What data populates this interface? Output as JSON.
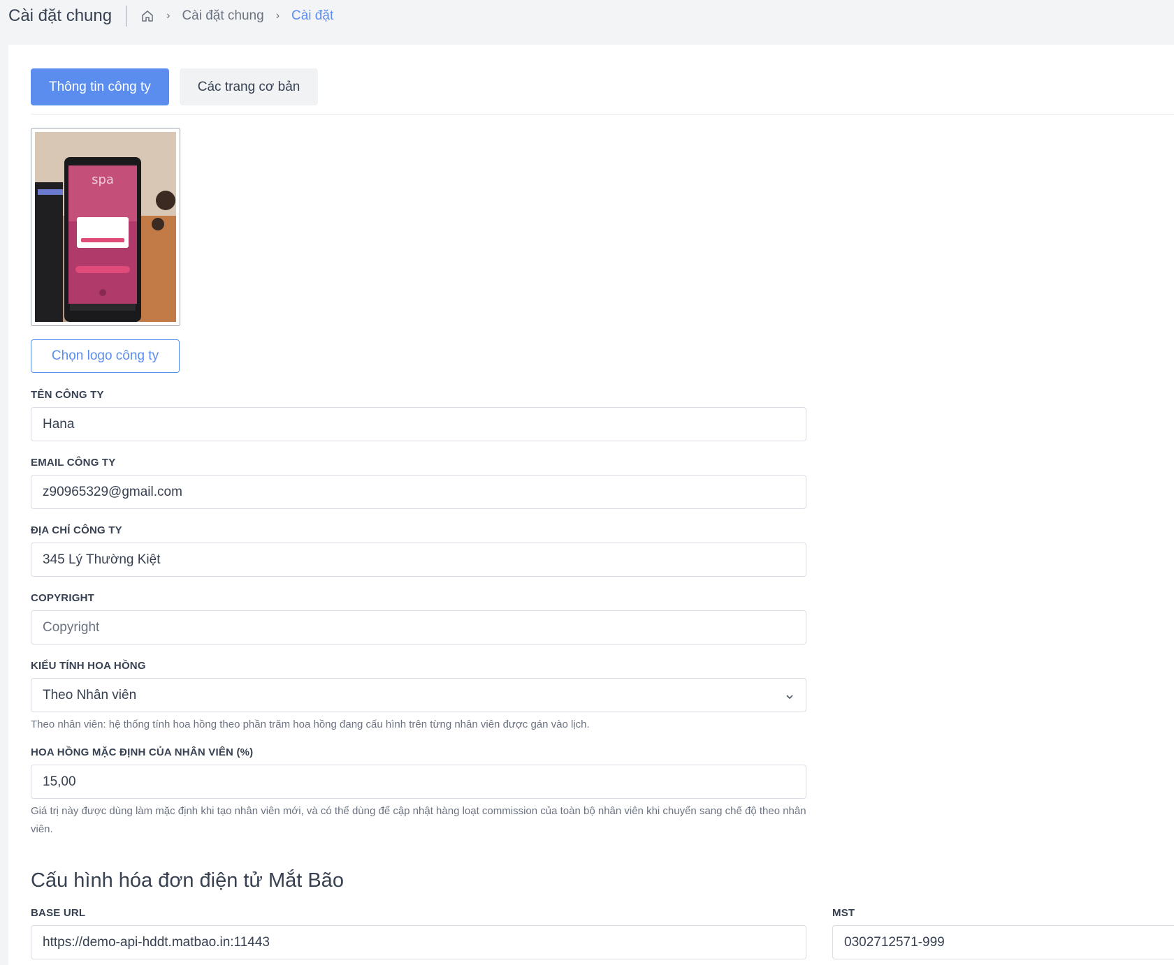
{
  "header": {
    "title": "Cài đặt chung",
    "breadcrumb": {
      "home_icon": "home-icon",
      "items": [
        "Cài đặt chung",
        "Cài đặt"
      ]
    }
  },
  "tabs": [
    {
      "label": "Thông tin công ty",
      "active": true
    },
    {
      "label": "Các trang cơ bản",
      "active": false
    }
  ],
  "logo": {
    "button_label": "Chọn logo công ty",
    "image_text": "spa"
  },
  "form": {
    "company_name": {
      "label": "TÊN CÔNG TY",
      "value": "Hana"
    },
    "company_email": {
      "label": "EMAIL CÔNG TY",
      "value": "z90965329@gmail.com"
    },
    "company_address": {
      "label": "ĐỊA CHỈ CÔNG TY",
      "value": "345 Lý Thường Kiệt"
    },
    "copyright": {
      "label": "COPYRIGHT",
      "placeholder": "Copyright"
    },
    "commission_type": {
      "label": "KIỂU TÍNH HOA HỒNG",
      "value": "Theo Nhân viên",
      "hint": "Theo nhân viên: hệ thống tính hoa hồng theo phần trăm hoa hồng đang cấu hình trên từng nhân viên được gán vào lịch."
    },
    "default_commission": {
      "label": "HOA HỒNG MẶC ĐỊNH CỦA NHÂN VIÊN (%)",
      "value": "15,00",
      "hint": "Giá trị này được dùng làm mặc định khi tạo nhân viên mới, và có thể dùng để cập nhật hàng loạt commission của toàn bộ nhân viên khi chuyển sang chế độ theo nhân viên."
    }
  },
  "invoice": {
    "title": "Cấu hình hóa đơn điện tử Mắt Bão",
    "base_url": {
      "label": "BASE URL",
      "value": "https://demo-api-hddt.matbao.in:11443"
    },
    "mst": {
      "label": "MST",
      "value": "0302712571-999"
    }
  },
  "colors": {
    "accent": "#5b8def",
    "background": "#f3f4f6",
    "card": "#ffffff"
  }
}
